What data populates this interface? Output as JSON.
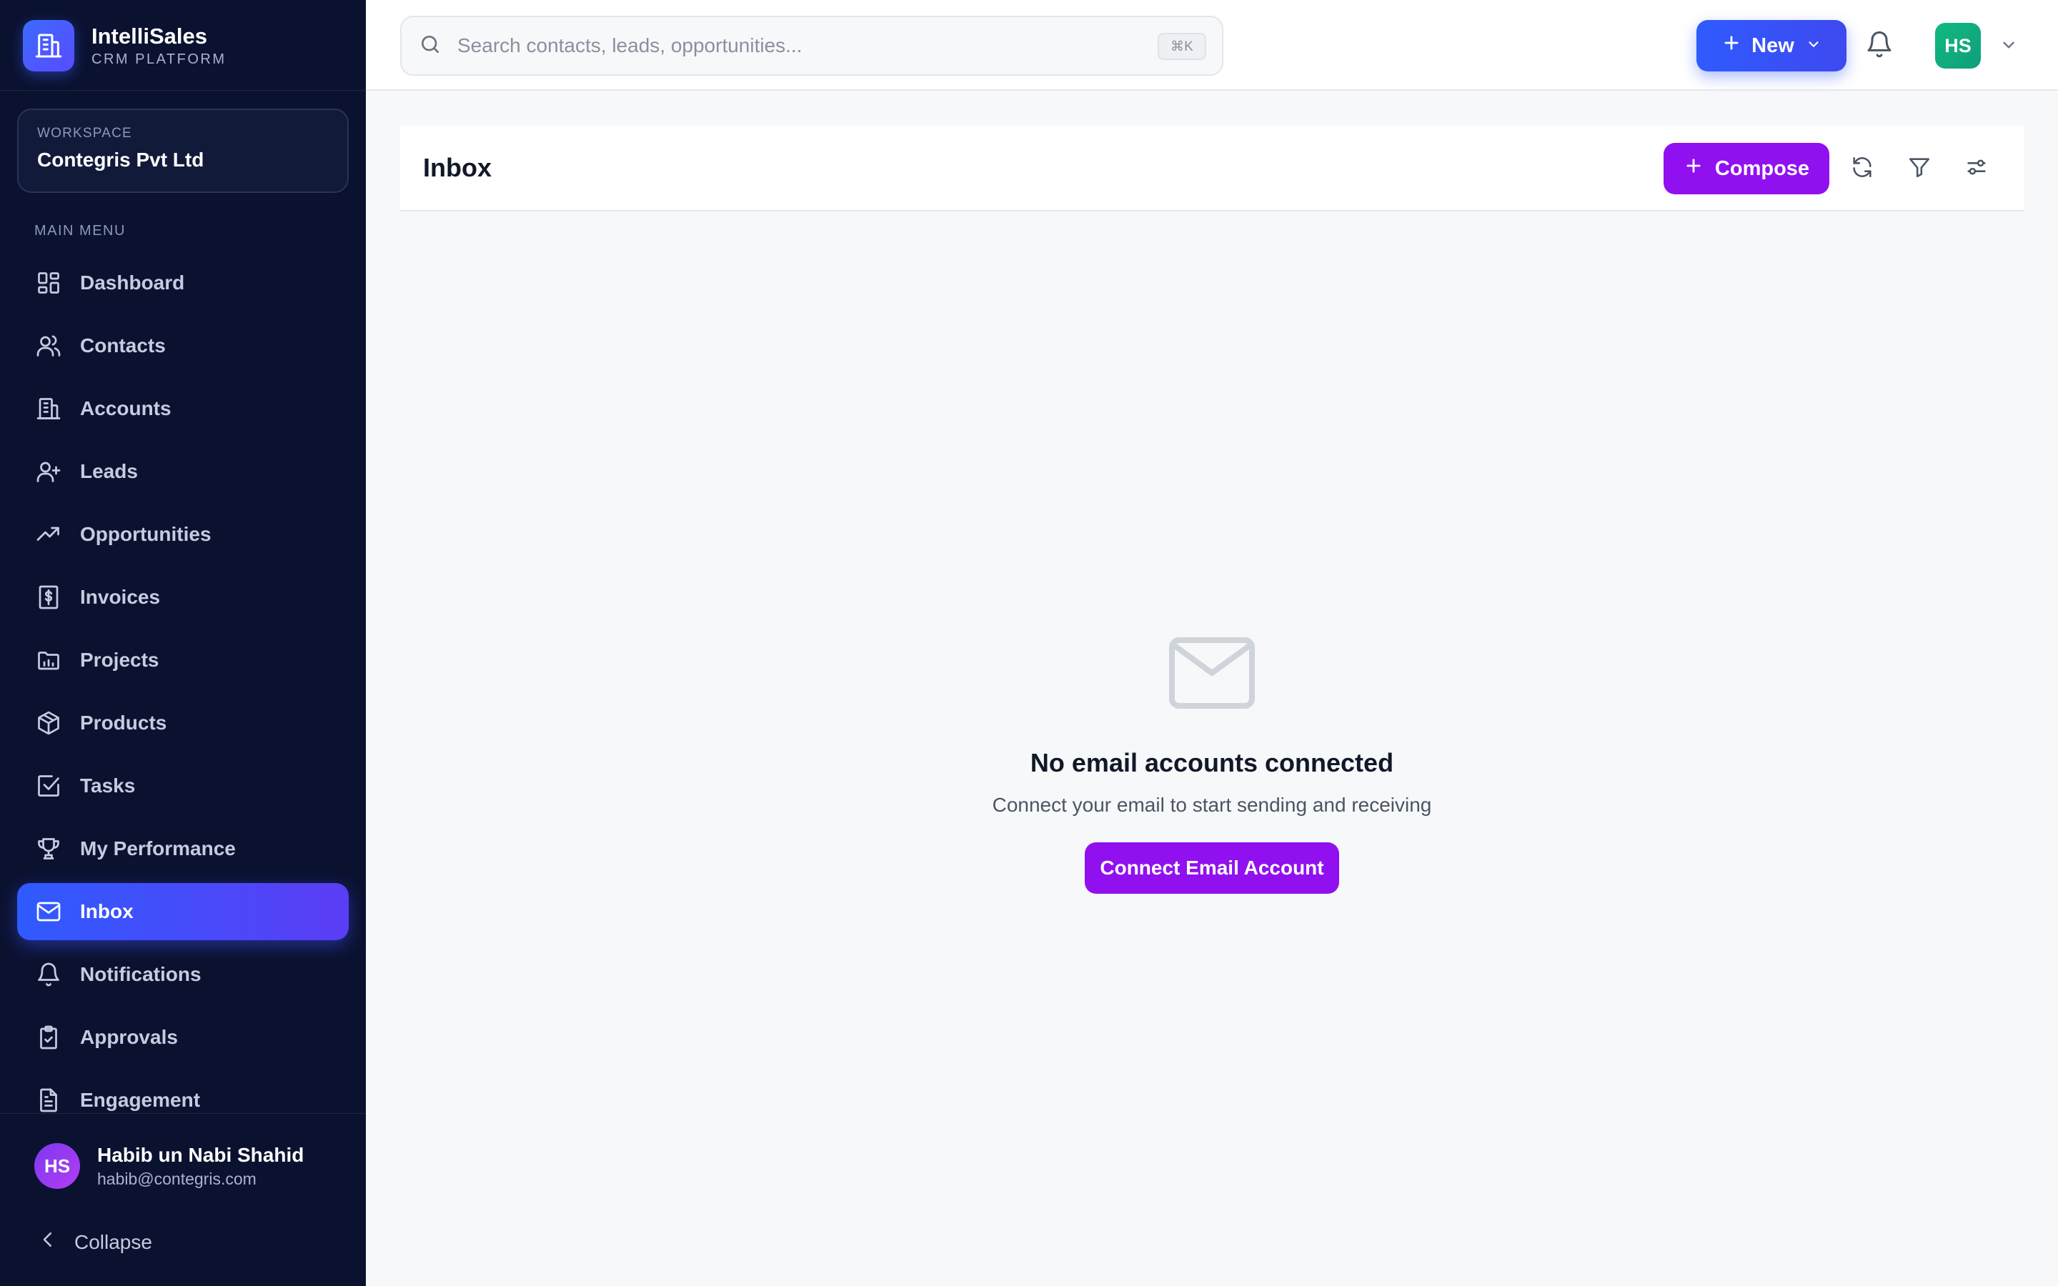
{
  "brand": {
    "name": "IntelliSales",
    "subtitle": "CRM PLATFORM",
    "logo_icon": "building-icon"
  },
  "workspace": {
    "label": "WORKSPACE",
    "name": "Contegris Pvt Ltd"
  },
  "sidebar": {
    "menu_label": "MAIN MENU",
    "items": [
      {
        "label": "Dashboard",
        "icon": "grid-icon",
        "active": false
      },
      {
        "label": "Contacts",
        "icon": "users-icon",
        "active": false
      },
      {
        "label": "Accounts",
        "icon": "building-icon",
        "active": false
      },
      {
        "label": "Leads",
        "icon": "user-plus-icon",
        "active": false
      },
      {
        "label": "Opportunities",
        "icon": "trending-up-icon",
        "active": false
      },
      {
        "label": "Invoices",
        "icon": "receipt-dollar-icon",
        "active": false
      },
      {
        "label": "Projects",
        "icon": "folder-chart-icon",
        "active": false
      },
      {
        "label": "Products",
        "icon": "package-icon",
        "active": false
      },
      {
        "label": "Tasks",
        "icon": "check-square-icon",
        "active": false
      },
      {
        "label": "My Performance",
        "icon": "trophy-icon",
        "active": false
      },
      {
        "label": "Inbox",
        "icon": "mail-icon",
        "active": true
      },
      {
        "label": "Notifications",
        "icon": "bell-icon",
        "active": false
      },
      {
        "label": "Approvals",
        "icon": "clipboard-check-icon",
        "active": false
      },
      {
        "label": "Engagement",
        "icon": "file-text-icon",
        "active": false
      }
    ],
    "user": {
      "initials": "HS",
      "name": "Habib un Nabi Shahid",
      "email": "habib@contegris.com"
    },
    "collapse_label": "Collapse"
  },
  "topbar": {
    "search_placeholder": "Search contacts, leads, opportunities...",
    "search_shortcut": "⌘K",
    "new_label": "New",
    "avatar_initials": "HS"
  },
  "main": {
    "title": "Inbox",
    "compose_label": "Compose",
    "empty_state": {
      "title": "No email accounts connected",
      "subtitle": "Connect your email to start sending and receiving",
      "button_label": "Connect Email Account"
    }
  },
  "colors": {
    "sidebar_bg": "#0b1230",
    "active_gradient_start": "#2f5bff",
    "active_gradient_end": "#5b3df5",
    "compose_purple": "#9110f0",
    "avatar_green": "#10b981"
  }
}
